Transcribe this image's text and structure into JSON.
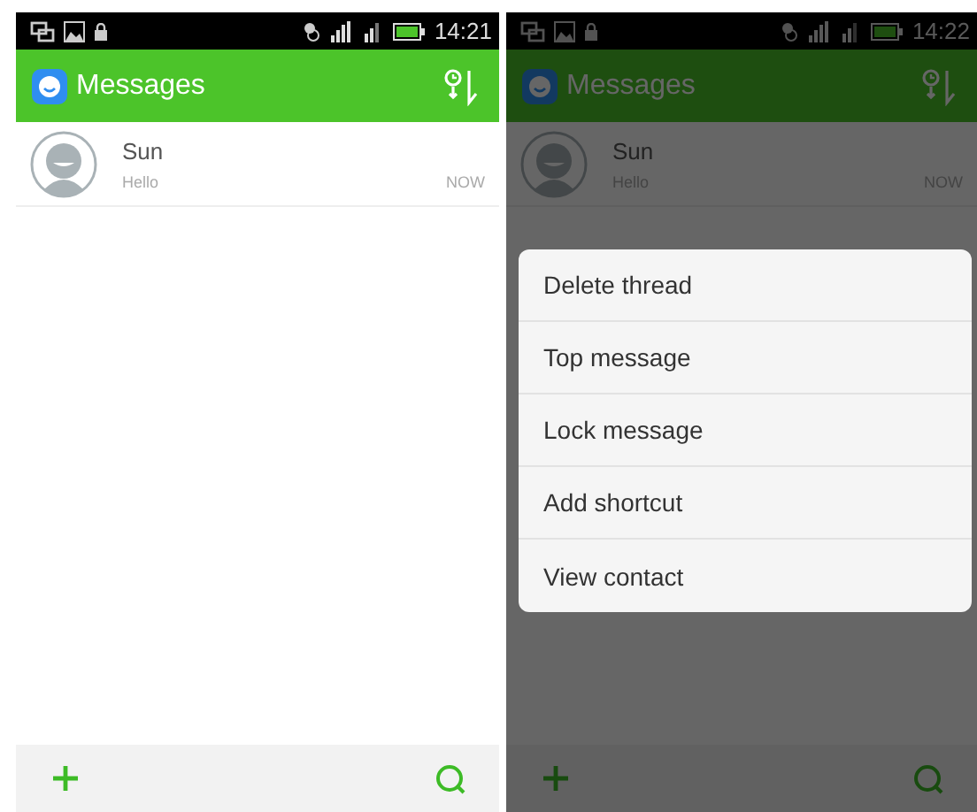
{
  "screens": [
    {
      "status_bar": {
        "time": "14:21"
      },
      "app_bar": {
        "title": "Messages"
      },
      "conversations": [
        {
          "name": "Sun",
          "preview": "Hello",
          "time": "NOW"
        }
      ],
      "dimmed": false
    },
    {
      "status_bar": {
        "time": "14:22"
      },
      "app_bar": {
        "title": "Messages"
      },
      "conversations": [
        {
          "name": "Sun",
          "preview": "Hello",
          "time": "NOW"
        }
      ],
      "dimmed": true,
      "context_menu": [
        {
          "label": "Delete thread"
        },
        {
          "label": "Top message"
        },
        {
          "label": "Lock message"
        },
        {
          "label": "Add shortcut"
        },
        {
          "label": "View contact"
        }
      ]
    }
  ]
}
